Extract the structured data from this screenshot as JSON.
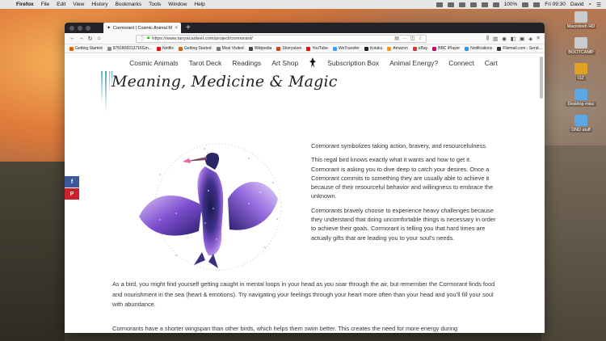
{
  "menubar": {
    "app": "Firefox",
    "items": [
      "File",
      "Edit",
      "View",
      "History",
      "Bookmarks",
      "Tools",
      "Window",
      "Help"
    ],
    "battery": "100%",
    "clock": "Fri 09:30",
    "user": "David"
  },
  "desktop": {
    "icons": [
      {
        "name": "Macintosh HD",
        "color": "#c9cbcf"
      },
      {
        "name": "BOOTCAMP",
        "color": "#c9cbcf"
      },
      {
        "name": "OZ",
        "color": "#e0a020"
      },
      {
        "name": "Desktop misc",
        "color": "#5aa8e6"
      },
      {
        "name": "DND stuff",
        "color": "#5aa8e6"
      }
    ]
  },
  "browser": {
    "tab_title": "Cormorant | Cosmic Animal Me",
    "url": "https://www.tanyacasteel.com/project/cormorant/",
    "bookmarks": [
      {
        "label": "Getting Started",
        "color": "#e66000"
      },
      {
        "label": "9781808213716Gm...",
        "color": "#8a8a8a"
      },
      {
        "label": "Netflix",
        "color": "#e50914"
      },
      {
        "label": "Getting Started",
        "color": "#e66000"
      },
      {
        "label": "Most Visited",
        "color": "#777777"
      },
      {
        "label": "Wikipedia",
        "color": "#444444"
      },
      {
        "label": "Shoryuken",
        "color": "#d04020"
      },
      {
        "label": "YouTube",
        "color": "#ff0000"
      },
      {
        "label": "WeTransfer",
        "color": "#409fff"
      },
      {
        "label": "Kotaku",
        "color": "#222222"
      },
      {
        "label": "Amazon",
        "color": "#ff9900"
      },
      {
        "label": "eBay",
        "color": "#e53238"
      },
      {
        "label": "BBC iPlayer",
        "color": "#d0006f"
      },
      {
        "label": "Notifications",
        "color": "#1da1f2"
      },
      {
        "label": "Filemail.com - Send...",
        "color": "#333333"
      }
    ]
  },
  "site": {
    "nav": [
      "Cosmic Animals",
      "Tarot Deck",
      "Readings",
      "Art Shop",
      "Subscription Box",
      "Animal Energy?",
      "Connect",
      "Cart"
    ],
    "heading": "Meaning, Medicine & Magic",
    "right_paragraphs": [
      "Cormorant symbolizes taking action, bravery, and resourcefulness.",
      "This regal bird knows exactly what it wants and how to get it. Cormorant is asking you to dive deep to catch your desires. Once a Cormorant commits to something they are usually able to achieve it because of their resourceful behavior and willingness to embrace the unknown.",
      "Cormorants bravely choose to experience heavy challenges because they understand that doing uncomfortable things is necessary in order to achieve their goals. Cormorant is telling you that hard times are actually gifts that are leading you to your soul’s needs."
    ],
    "wide_paragraphs": [
      "As a bird, you might find yourself getting caught in mental loops in your head as you soar through the air, but remember the Cormorant finds food and nourishment in the sea (heart & emotions). Try navigating your feelings through your heart more often than your head and you’ll fill your soul with abundance.",
      "Cormorants have a shorter wingspan than other birds, which helps them swim better. This creates the need for more energy during"
    ],
    "share": {
      "facebook": "f",
      "pinterest": "P"
    }
  }
}
